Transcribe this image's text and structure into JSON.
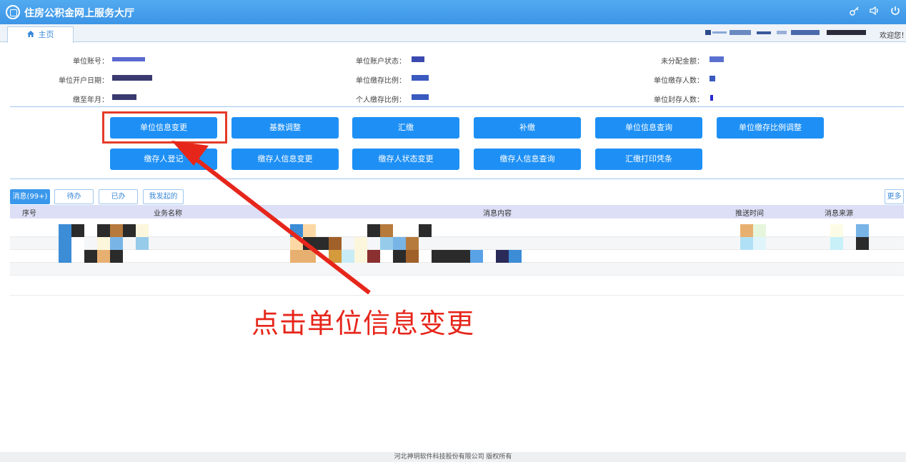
{
  "header": {
    "app_title": "住房公积金网上服务大厅",
    "icons": [
      "key-icon",
      "volume-icon",
      "power-icon"
    ]
  },
  "tabs": {
    "home_label": "主页",
    "welcome_text": "欢迎您！"
  },
  "info": {
    "labels": {
      "unit_account": "单位账号：",
      "open_date": "单位开户日期：",
      "paid_until": "缴至年月：",
      "account_status": "单位账户状态：",
      "unit_ratio": "单位缴存比例：",
      "personal_ratio": "个人缴存比例：",
      "unallocated": "未分配金额：",
      "depositors": "单位缴存人数：",
      "sealed_count": "单位封存人数："
    }
  },
  "buttons": {
    "row1": [
      "单位信息变更",
      "基数调整",
      "汇缴",
      "补缴",
      "单位信息查询",
      "单位缴存比例调整"
    ],
    "row2": [
      "缴存人登记",
      "缴存人信息变更",
      "缴存人状态变更",
      "缴存人信息查询",
      "汇缴打印凭条"
    ]
  },
  "messages": {
    "tabs": [
      "消息(99+)",
      "待办",
      "已办",
      "我发起的"
    ],
    "more": "更多···",
    "columns": [
      "序号",
      "业务名称",
      "消息内容",
      "推送时间",
      "消息来源"
    ]
  },
  "annotation": {
    "text": "点击单位信息变更",
    "color": "#e6261b"
  },
  "footer": {
    "text": "河北神玥软件科技股份有限公司 版权所有"
  },
  "colors": {
    "header_bg": "#4aa3ee",
    "button_bg": "#1e90f5",
    "highlight": "#e43b2a"
  }
}
